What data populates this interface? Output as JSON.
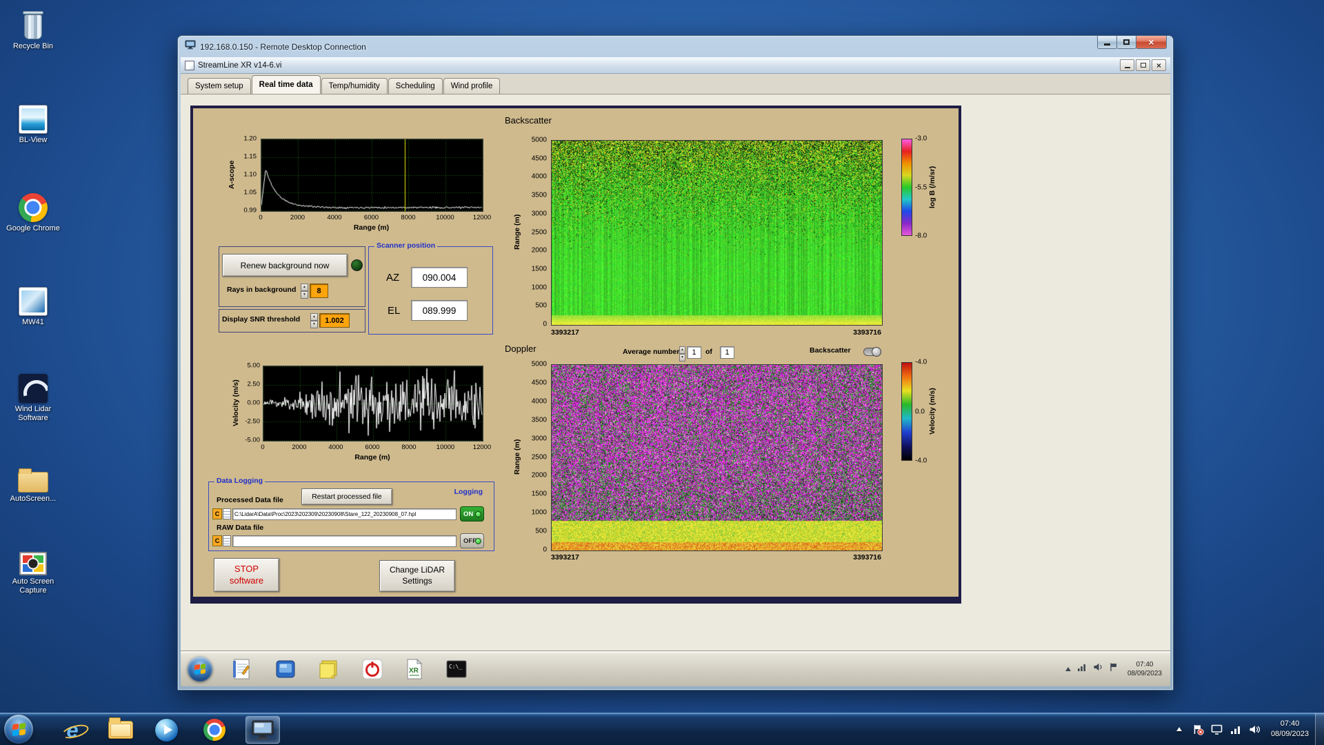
{
  "desktop": {
    "icons": [
      {
        "id": "recycle-bin",
        "label": "Recycle Bin"
      },
      {
        "id": "bl-view",
        "label": "BL-View"
      },
      {
        "id": "google-chrome",
        "label": "Google Chrome"
      },
      {
        "id": "mw41",
        "label": "MW41"
      },
      {
        "id": "wind-lidar-software",
        "label": "Wind Lidar Software"
      },
      {
        "id": "autoscreen",
        "label": "AutoScreen..."
      },
      {
        "id": "auto-screen-capture",
        "label": "Auto Screen Capture"
      }
    ]
  },
  "rdp_window": {
    "title": "192.168.0.150 - Remote Desktop Connection"
  },
  "app_window": {
    "title": "StreamLine XR v14-6.vi",
    "tabs": [
      {
        "label": "System setup",
        "active": false
      },
      {
        "label": "Real time data",
        "active": true
      },
      {
        "label": "Temp/humidity",
        "active": false
      },
      {
        "label": "Scheduling",
        "active": false
      },
      {
        "label": "Wind profile",
        "active": false
      }
    ]
  },
  "panel": {
    "renew_button_label": "Renew background now",
    "rays_label": "Rays in background",
    "rays_value": "8",
    "snr_label": "Display SNR threshold",
    "snr_value": "1.002",
    "scanner_position": {
      "title": "Scanner position",
      "az_label": "AZ",
      "az_value": "090.004",
      "el_label": "EL",
      "el_value": "089.999"
    },
    "backscatter_title": "Backscatter",
    "doppler_title": "Doppler",
    "average_label": "Average number",
    "average_value": "1",
    "of_label": "of",
    "average_total": "1",
    "backscatter_toggle_label": "Backscatter",
    "data_logging": {
      "title": "Data Logging",
      "logging_label": "Logging",
      "processed_label": "Processed Data file",
      "restart_button_label": "Restart processed file",
      "processed_drive": "C",
      "processed_path": "C:\\LidarA\\Data\\Proc\\2023\\202309\\20230908\\Stare_122_20230908_07.hpl",
      "on_label": "ON",
      "raw_label": "RAW Data file",
      "raw_drive": "C",
      "raw_path": "",
      "off_label": "OFF"
    },
    "stop_button_line1": "STOP",
    "stop_button_line2": "software",
    "settings_button_line1": "Change LiDAR",
    "settings_button_line2": "Settings"
  },
  "plots": {
    "ascope": {
      "type": "line",
      "ylabel": "A-scope",
      "xlabel": "Range (m)",
      "yticks": [
        "1.20",
        "1.15",
        "1.10",
        "1.05",
        "0.99"
      ],
      "xticks": [
        "0",
        "2000",
        "4000",
        "6000",
        "8000",
        "10000",
        "12000"
      ],
      "xrange": [
        0,
        12000
      ],
      "yrange": [
        0.99,
        1.2
      ],
      "cursor_x": 7800,
      "cursor_color": "#e8f000",
      "trace_color": "#ffffff",
      "grid_color": "#1e6a1e",
      "bg": "#000000"
    },
    "velocity": {
      "type": "line",
      "ylabel": "Velocity (m/s)",
      "xlabel": "Range (m)",
      "yticks": [
        "5.00",
        "2.50",
        "0.00",
        "-2.50",
        "-5.00"
      ],
      "xticks": [
        "0",
        "2000",
        "4000",
        "6000",
        "8000",
        "10000",
        "12000"
      ],
      "xrange": [
        0,
        12000
      ],
      "yrange": [
        -5,
        5
      ],
      "trace_color": "#ffffff",
      "grid_color": "#1e6a1e",
      "bg": "#000000"
    },
    "backscatter": {
      "type": "heatmap",
      "ylabel": "Range (m)",
      "yticks": [
        "5000",
        "4500",
        "4000",
        "3500",
        "3000",
        "2500",
        "2000",
        "1500",
        "1000",
        "500",
        "0"
      ],
      "x_start_label": "3393217",
      "x_end_label": "3393716",
      "colorbar": {
        "label": "log B (/m/sr)",
        "ticks": [
          "-3.0",
          "-5.5",
          "-8.0"
        ],
        "gradient": [
          "#ff5ce4",
          "#e82020",
          "#f09000",
          "#d8d820",
          "#28c828",
          "#20c8c8",
          "#2048e8",
          "#8828c8",
          "#e858d8"
        ]
      }
    },
    "doppler": {
      "type": "heatmap",
      "ylabel": "Range (m)",
      "yticks": [
        "5000",
        "4500",
        "4000",
        "3500",
        "3000",
        "2500",
        "2000",
        "1500",
        "1000",
        "500",
        "0"
      ],
      "x_start_label": "3393217",
      "x_end_label": "3393716",
      "colorbar": {
        "label": "Velocity (m/s)",
        "ticks": [
          "-4.0",
          "0.0",
          "-4.0"
        ],
        "gradient": [
          "#c01010",
          "#f07010",
          "#e8e020",
          "#28b828",
          "#20b8c8",
          "#2040d0",
          "#101060",
          "#000000"
        ]
      }
    }
  },
  "remote_taskbar": {
    "icons": [
      "journal",
      "display",
      "sticky-notes",
      "power",
      "xr-file",
      "console"
    ],
    "tray_icons": [
      "network",
      "volume",
      "flag"
    ],
    "clock_time": "07:40",
    "clock_date": "08/09/2023"
  },
  "taskbar": {
    "pinned": [
      "internet-explorer",
      "windows-explorer",
      "media-player",
      "chrome",
      "remote-desktop"
    ],
    "tray_icons": [
      "show-hidden",
      "action-center-flag",
      "display",
      "network",
      "volume"
    ],
    "clock_time": "07:40",
    "clock_date": "08/09/2023"
  }
}
